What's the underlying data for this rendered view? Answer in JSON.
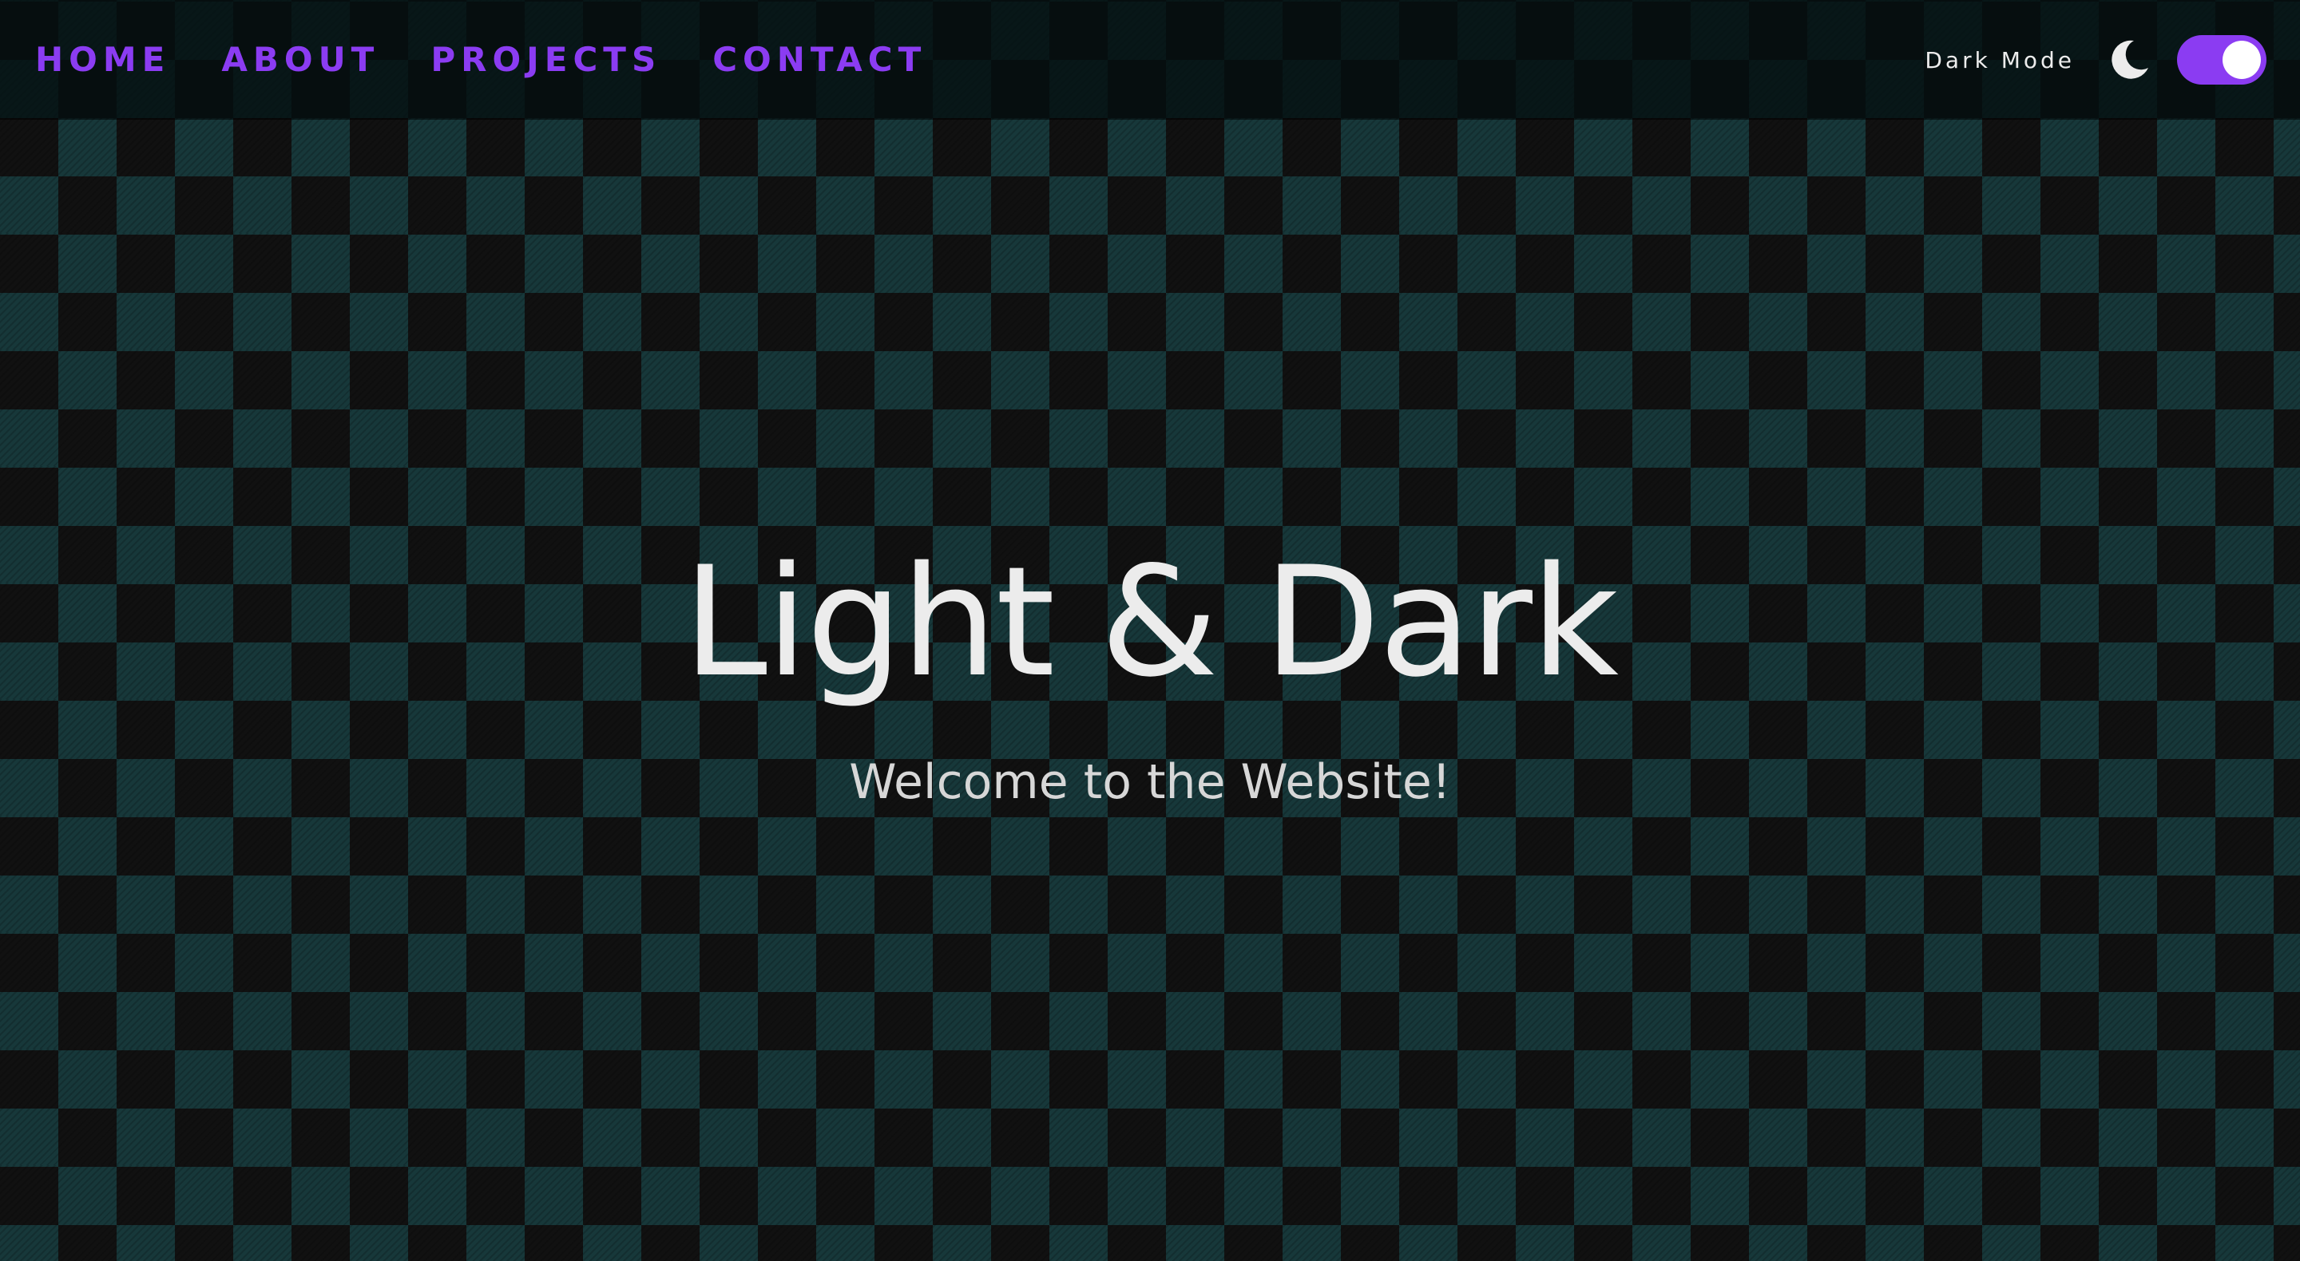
{
  "nav": {
    "items": [
      {
        "label": "HOME"
      },
      {
        "label": "ABOUT"
      },
      {
        "label": "PROJECTS"
      },
      {
        "label": "CONTACT"
      }
    ]
  },
  "theme_toggle": {
    "label": "Dark Mode",
    "icon": "moon-icon",
    "enabled": true
  },
  "hero": {
    "title": "Light & Dark",
    "subtitle": "Welcome to the Website!"
  },
  "colors": {
    "accent": "#8b3cf2",
    "background_dark": "#111111",
    "background_teal": "#17383a",
    "text": "#ececec"
  }
}
